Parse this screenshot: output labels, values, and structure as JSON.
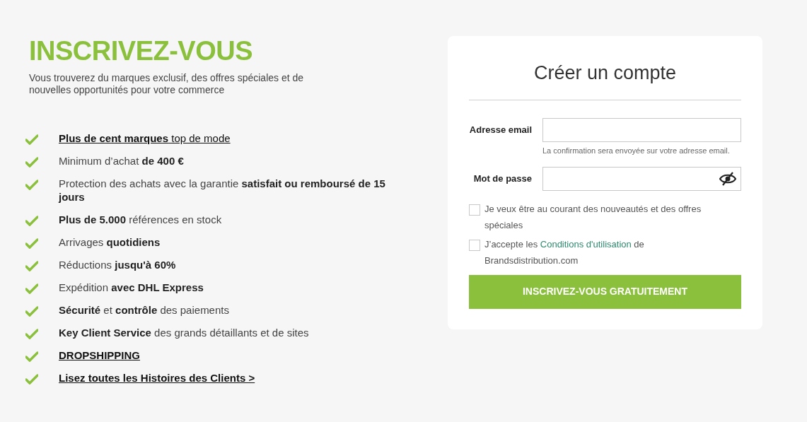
{
  "intro": {
    "title": "INSCRIVEZ-VOUS",
    "subtitle": "Vous trouverez du marques exclusif, des offres spéciales et de nouvelles opportunités pour votre commerce"
  },
  "benefits": [
    {
      "kind": "link",
      "text": "**Plus de cent marques** top de mode"
    },
    {
      "kind": "text",
      "text": "Minimum d’achat **de 400 €**"
    },
    {
      "kind": "text",
      "text": "Protection des achats avec la garantie **satisfait ou remboursé de 15 jours**"
    },
    {
      "kind": "text",
      "text": "**Plus de 5.000** références en stock"
    },
    {
      "kind": "text",
      "text": "Arrivages **quotidiens**"
    },
    {
      "kind": "text",
      "text": "Réductions **jusqu'à 60%**"
    },
    {
      "kind": "text",
      "text": "Expédition **avec DHL Express**"
    },
    {
      "kind": "text",
      "text": "**Sécurité** et **contrôle** des paiements"
    },
    {
      "kind": "text",
      "text": "**Key Client Service** des grands détaillants et de sites"
    },
    {
      "kind": "link",
      "text": "**DROPSHIPPING**"
    },
    {
      "kind": "link",
      "text": "**Lisez toutes les Histoires des Clients >**"
    }
  ],
  "form": {
    "title": "Créer un compte",
    "email": {
      "label": "Adresse email",
      "hint": "La confirmation sera envoyée sur votre adresse email."
    },
    "password": {
      "label": "Mot de passe",
      "visible": false
    },
    "newsletter": {
      "checked": false,
      "text": "Je veux être au courant des nouveautés et des offres spéciales"
    },
    "terms": {
      "checked": false,
      "before": "J’accepte les",
      "link": "Conditions d'utilisation",
      "after": "de Brandsdistribution.com"
    },
    "submit": "INSCRIVEZ-VOUS GRATUITEMENT"
  }
}
